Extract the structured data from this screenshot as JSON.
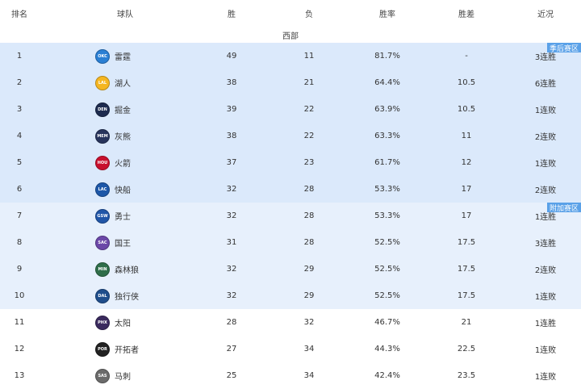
{
  "headers": {
    "rank": "排名",
    "team": "球队",
    "wins": "胜",
    "losses": "负",
    "pct": "胜率",
    "gb": "胜差",
    "streak": "近况"
  },
  "section_title": "西部",
  "zones": {
    "playoff": "季后赛区",
    "playin": "附加赛区"
  },
  "rows": [
    {
      "rank": "1",
      "team": "雷霆",
      "abbr": "OKC",
      "color": "#2a7fd4",
      "w": "49",
      "l": "11",
      "pct": "81.7%",
      "gb": "-",
      "streak": "3连胜",
      "zone": "playoff"
    },
    {
      "rank": "2",
      "team": "湖人",
      "abbr": "LAL",
      "color": "#f5b622",
      "w": "38",
      "l": "21",
      "pct": "64.4%",
      "gb": "10.5",
      "streak": "6连胜",
      "zone": "playoff"
    },
    {
      "rank": "3",
      "team": "掘金",
      "abbr": "DEN",
      "color": "#1d2b4f",
      "w": "39",
      "l": "22",
      "pct": "63.9%",
      "gb": "10.5",
      "streak": "1连败",
      "zone": "playoff"
    },
    {
      "rank": "4",
      "team": "灰熊",
      "abbr": "MEM",
      "color": "#27345c",
      "w": "38",
      "l": "22",
      "pct": "63.3%",
      "gb": "11",
      "streak": "2连败",
      "zone": "playoff"
    },
    {
      "rank": "5",
      "team": "火箭",
      "abbr": "HOU",
      "color": "#c8102e",
      "w": "37",
      "l": "23",
      "pct": "61.7%",
      "gb": "12",
      "streak": "1连败",
      "zone": "playoff"
    },
    {
      "rank": "6",
      "team": "快船",
      "abbr": "LAC",
      "color": "#1d57a8",
      "w": "32",
      "l": "28",
      "pct": "53.3%",
      "gb": "17",
      "streak": "2连败",
      "zone": "playoff"
    },
    {
      "rank": "7",
      "team": "勇士",
      "abbr": "GSW",
      "color": "#2156a8",
      "w": "32",
      "l": "28",
      "pct": "53.3%",
      "gb": "17",
      "streak": "1连胜",
      "zone": "playin"
    },
    {
      "rank": "8",
      "team": "国王",
      "abbr": "SAC",
      "color": "#6b47a8",
      "w": "31",
      "l": "28",
      "pct": "52.5%",
      "gb": "17.5",
      "streak": "3连胜",
      "zone": "playin"
    },
    {
      "rank": "9",
      "team": "森林狼",
      "abbr": "MIN",
      "color": "#2f6e4a",
      "w": "32",
      "l": "29",
      "pct": "52.5%",
      "gb": "17.5",
      "streak": "2连败",
      "zone": "playin"
    },
    {
      "rank": "10",
      "team": "独行侠",
      "abbr": "DAL",
      "color": "#1f4e8c",
      "w": "32",
      "l": "29",
      "pct": "52.5%",
      "gb": "17.5",
      "streak": "1连败",
      "zone": "playin"
    },
    {
      "rank": "11",
      "team": "太阳",
      "abbr": "PHX",
      "color": "#3a2a5e",
      "w": "28",
      "l": "32",
      "pct": "46.7%",
      "gb": "21",
      "streak": "1连胜",
      "zone": "normal"
    },
    {
      "rank": "12",
      "team": "开拓者",
      "abbr": "POR",
      "color": "#222222",
      "w": "27",
      "l": "34",
      "pct": "44.3%",
      "gb": "22.5",
      "streak": "1连败",
      "zone": "normal"
    },
    {
      "rank": "13",
      "team": "马刺",
      "abbr": "SAS",
      "color": "#6b6b6b",
      "w": "25",
      "l": "34",
      "pct": "42.4%",
      "gb": "23.5",
      "streak": "1连败",
      "zone": "normal"
    }
  ]
}
